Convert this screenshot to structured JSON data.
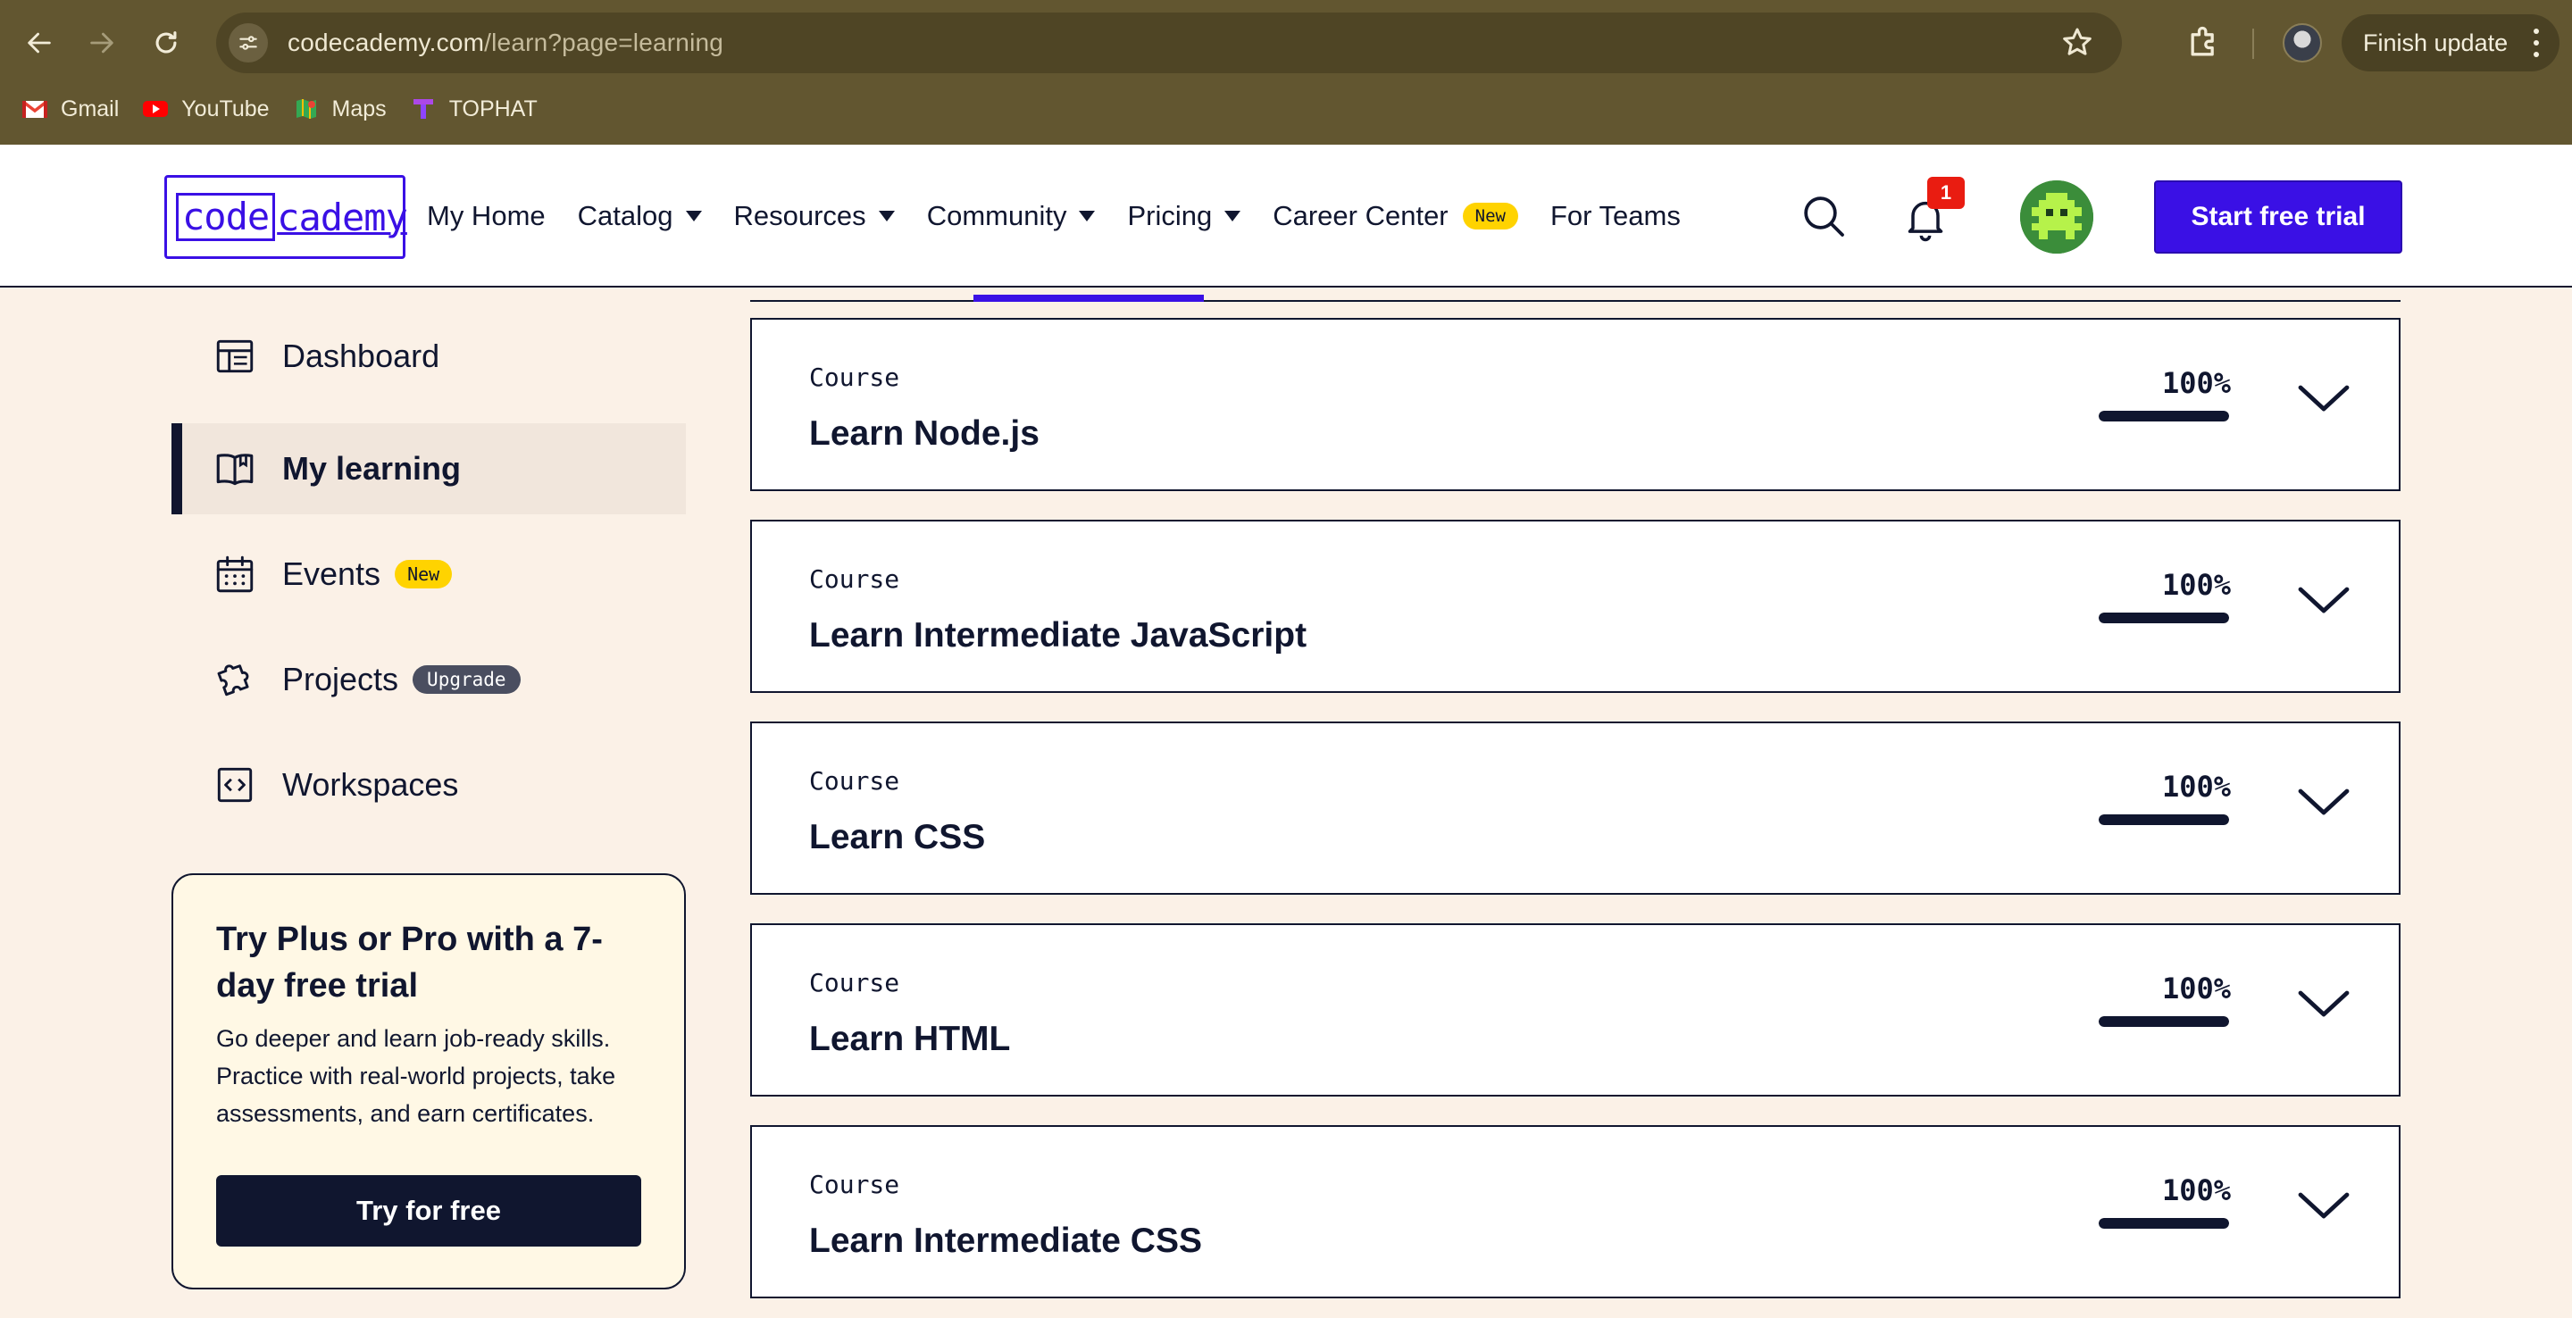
{
  "browser": {
    "url_host": "codecademy.com",
    "url_path": "/learn?page=learning",
    "finish_update_label": "Finish update",
    "bookmarks": [
      {
        "label": "Gmail",
        "icon": "gmail-icon",
        "color": "#ea4335"
      },
      {
        "label": "YouTube",
        "icon": "youtube-icon",
        "color": "#ff0000"
      },
      {
        "label": "Maps",
        "icon": "maps-icon",
        "color": "#34a853"
      },
      {
        "label": "TOPHAT",
        "icon": "tophat-icon",
        "color": "#8e44ff"
      }
    ]
  },
  "header": {
    "logo_part1": "code",
    "logo_part2": "cademy",
    "nav": [
      {
        "label": "My Home",
        "has_caret": false
      },
      {
        "label": "Catalog",
        "has_caret": true
      },
      {
        "label": "Resources",
        "has_caret": true
      },
      {
        "label": "Community",
        "has_caret": true
      },
      {
        "label": "Pricing",
        "has_caret": true
      },
      {
        "label": "Career Center",
        "has_caret": false,
        "badge": "New"
      },
      {
        "label": "For Teams",
        "has_caret": false
      }
    ],
    "notification_count": "1",
    "cta_label": "Start free trial",
    "accent_color": "#3a10e5"
  },
  "sidebar": {
    "items": [
      {
        "label": "Dashboard",
        "icon": "dashboard-icon"
      },
      {
        "label": "My learning",
        "icon": "book-icon",
        "active": true
      },
      {
        "label": "Events",
        "icon": "calendar-icon",
        "badge": "New"
      },
      {
        "label": "Projects",
        "icon": "puzzle-icon",
        "badge": "Upgrade"
      },
      {
        "label": "Workspaces",
        "icon": "code-brackets-icon"
      }
    ],
    "promo": {
      "title": "Try Plus or Pro with a 7-day free trial",
      "body": "Go deeper and learn job-ready skills. Practice with real-world projects, take assessments, and earn certificates.",
      "button_label": "Try for free"
    }
  },
  "courses": [
    {
      "kind": "Course",
      "name": "Learn Node.js",
      "progress_label": "100%",
      "progress": 1.0
    },
    {
      "kind": "Course",
      "name": "Learn Intermediate JavaScript",
      "progress_label": "100%",
      "progress": 1.0
    },
    {
      "kind": "Course",
      "name": "Learn CSS",
      "progress_label": "100%",
      "progress": 1.0
    },
    {
      "kind": "Course",
      "name": "Learn HTML",
      "progress_label": "100%",
      "progress": 1.0
    },
    {
      "kind": "Course",
      "name": "Learn Intermediate CSS",
      "progress_label": "100%",
      "progress": 1.0
    }
  ]
}
